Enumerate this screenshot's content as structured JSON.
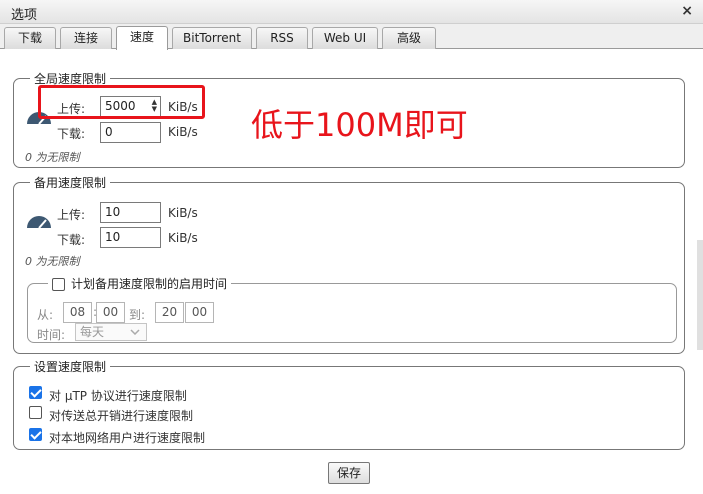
{
  "window": {
    "title": "选项",
    "close_glyph": "×"
  },
  "tabs": [
    {
      "label": "下载"
    },
    {
      "label": "连接"
    },
    {
      "label": "速度"
    },
    {
      "label": "BitTorrent"
    },
    {
      "label": "RSS"
    },
    {
      "label": "Web UI"
    },
    {
      "label": "高级"
    }
  ],
  "active_tab": "速度",
  "global_limits": {
    "legend": "全局速度限制",
    "upload_label": "上传:",
    "upload_value": "5000",
    "download_label": "下载:",
    "download_value": "0",
    "unit": "KiB/s",
    "note": "0 为无限制",
    "icon": "speedometer-icon"
  },
  "annotation": {
    "text": "低于100M即可",
    "color": "#e8141b"
  },
  "alt_limits": {
    "legend": "备用速度限制",
    "upload_label": "上传:",
    "upload_value": "10",
    "download_label": "下载:",
    "download_value": "10",
    "unit": "KiB/s",
    "note": "0 为无限制",
    "icon": "speedometer-icon",
    "schedule": {
      "legend": "计划备用速度限制的启用时间",
      "enabled": false,
      "from_label": "从:",
      "from_hour": "08",
      "from_minute": "00",
      "to_label": "到:",
      "to_hour": "20",
      "to_minute": "00",
      "time_label": "时间:",
      "days_value": "每天"
    }
  },
  "rate_settings": {
    "legend": "设置速度限制",
    "options": [
      {
        "label": "对 µTP 协议进行速度限制",
        "checked": true
      },
      {
        "label": "对传送总开销进行速度限制",
        "checked": false
      },
      {
        "label": "对本地网络用户进行速度限制",
        "checked": true
      }
    ]
  },
  "save_label": "保存",
  "colors": {
    "accent": "#1a73e8",
    "highlight": "#e8141b"
  }
}
